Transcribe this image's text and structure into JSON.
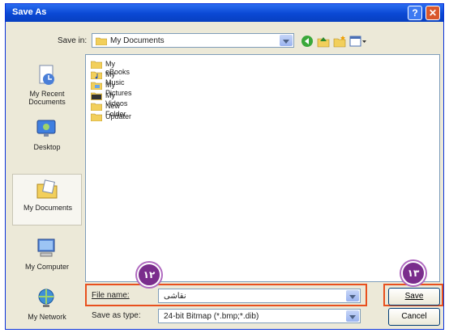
{
  "dialog": {
    "title": "Save As"
  },
  "toolbar": {
    "save_in_label": "Save in:",
    "save_in_value": "My Documents"
  },
  "places": [
    {
      "label": "My Recent Documents",
      "icon": "recent-documents-icon"
    },
    {
      "label": "Desktop",
      "icon": "desktop-icon"
    },
    {
      "label": "My Documents",
      "icon": "my-documents-icon"
    },
    {
      "label": "My Computer",
      "icon": "my-computer-icon"
    },
    {
      "label": "My Network",
      "icon": "my-network-icon"
    }
  ],
  "files": [
    {
      "name": "My eBooks",
      "icon": "folder-icon"
    },
    {
      "name": "My Music",
      "icon": "music-folder-icon"
    },
    {
      "name": "My Pictures",
      "icon": "pictures-folder-icon"
    },
    {
      "name": "My Videos",
      "icon": "videos-folder-icon"
    },
    {
      "name": "New Folder",
      "icon": "folder-icon"
    },
    {
      "name": "Updater",
      "icon": "folder-icon"
    }
  ],
  "form": {
    "file_name_label": "File name:",
    "file_name_value": "نقاشی",
    "save_as_type_label": "Save as type:",
    "save_as_type_value": "24-bit Bitmap (*.bmp;*.dib)"
  },
  "buttons": {
    "save": "Save",
    "cancel": "Cancel"
  },
  "annotations": {
    "badge_left": "۱۲",
    "badge_right": "۱۳"
  },
  "colors": {
    "titlebar": "#0a48d4",
    "highlight": "#e8501e",
    "badge": "#7a2d8c"
  }
}
